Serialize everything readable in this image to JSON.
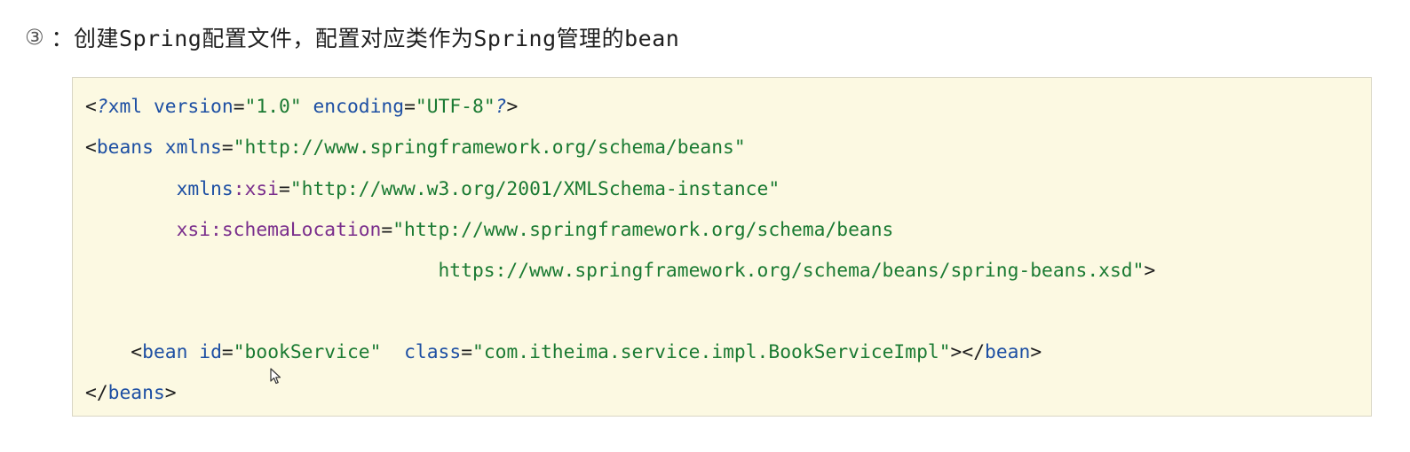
{
  "heading": {
    "number": "③",
    "title": "：创建Spring配置文件，配置对应类作为Spring管理的bean"
  },
  "code": {
    "line1": {
      "open": "<",
      "pi_q1": "?",
      "tag": "xml",
      "sp1": " ",
      "attr1": "version",
      "eq1": "=",
      "val1": "\"1.0\"",
      "sp2": " ",
      "attr2": "encoding",
      "eq2": "=",
      "val2": "\"UTF-8\"",
      "pi_q2": "?",
      "close": ">"
    },
    "line2": {
      "open": "<",
      "tag": "beans",
      "sp1": " ",
      "attr": "xmlns",
      "eq": "=",
      "val": "\"http://www.springframework.org/schema/beans\""
    },
    "line3": {
      "indent": "        ",
      "attr": "xmlns",
      "colon": ":",
      "ns": "xsi",
      "eq": "=",
      "val": "\"http://www.w3.org/2001/XMLSchema-instance\""
    },
    "line4": {
      "indent": "        ",
      "ns": "xsi:schemaLocation",
      "eq": "=",
      "val": "\"http://www.springframework.org/schema/beans"
    },
    "line5": {
      "indent": "                               ",
      "val": "https://www.springframework.org/schema/beans/spring-beans.xsd\"",
      "close": ">"
    },
    "line6": {
      "indent": "    ",
      "open": "<",
      "tag": "bean",
      "sp1": " ",
      "attr1": "id",
      "eq1": "=",
      "val1": "\"bookService\"",
      "sp2": "  ",
      "attr2": "class",
      "eq2": "=",
      "val2": "\"com.itheima.service.impl.BookServiceImpl\"",
      "mid": "></",
      "tag2": "bean",
      "close": ">"
    },
    "line7": {
      "open": "</",
      "tag": "beans",
      "close": ">"
    }
  }
}
